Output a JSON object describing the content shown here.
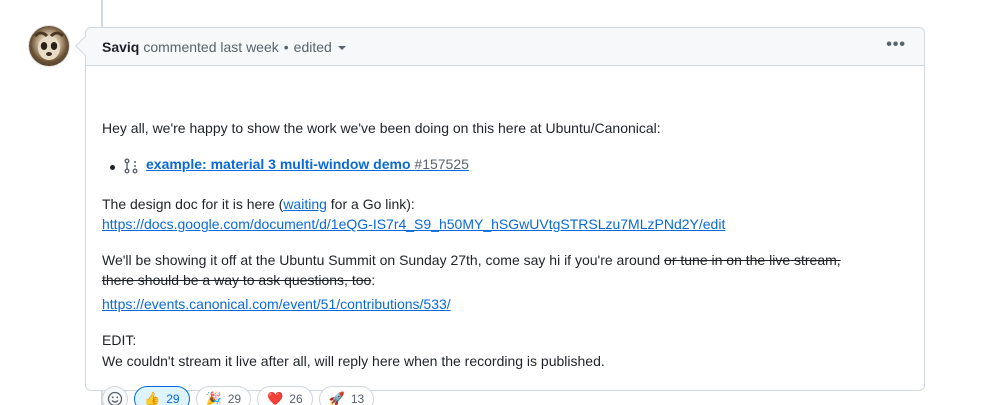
{
  "comment": {
    "author": "Saviq",
    "action": "commented last week",
    "separator": "•",
    "edited_label": "edited",
    "more_label": "•••",
    "intro": "Hey all, we're happy to show the work we've been doing on this here at Ubuntu/Canonical:",
    "pr": {
      "title": "example: material 3 multi-window demo",
      "number": "#157525"
    },
    "design_doc": {
      "prefix": "The design doc for it is here (",
      "link_word": "waiting",
      "suffix": " for a Go link):",
      "url": "https://docs.google.com/document/d/1eQG-IS7r4_S9_h50MY_hSGwUVtgSTRSLzu7MLzPNd2Y/edit"
    },
    "summit": {
      "text": "We'll be showing it off at the Ubuntu Summit on Sunday 27th, come say hi if you're around ",
      "strike_line1": "or tune in on the live stream,",
      "strike_line2": "there should be a way to ask questions, too",
      "after_strike": ":",
      "url": "https://events.canonical.com/event/51/contributions/533/"
    },
    "edit": {
      "label": "EDIT:",
      "text": "We couldn't stream it live after all, will reply here when the recording is published."
    },
    "reactions": [
      {
        "emoji": "👍",
        "count": "29",
        "icon": "thumbs-up-icon",
        "active": true
      },
      {
        "emoji": "🎉",
        "count": "29",
        "icon": "tada-icon",
        "active": false
      },
      {
        "emoji": "❤️",
        "count": "26",
        "icon": "heart-icon",
        "active": false
      },
      {
        "emoji": "🚀",
        "count": "13",
        "icon": "rocket-icon",
        "active": false
      }
    ],
    "add_reaction_icon": "smiley-icon"
  },
  "colors": {
    "link": "#0969da",
    "border": "#d0d7de",
    "header_bg": "#f6f8fa",
    "active_reaction_bg": "#ddf4ff"
  }
}
